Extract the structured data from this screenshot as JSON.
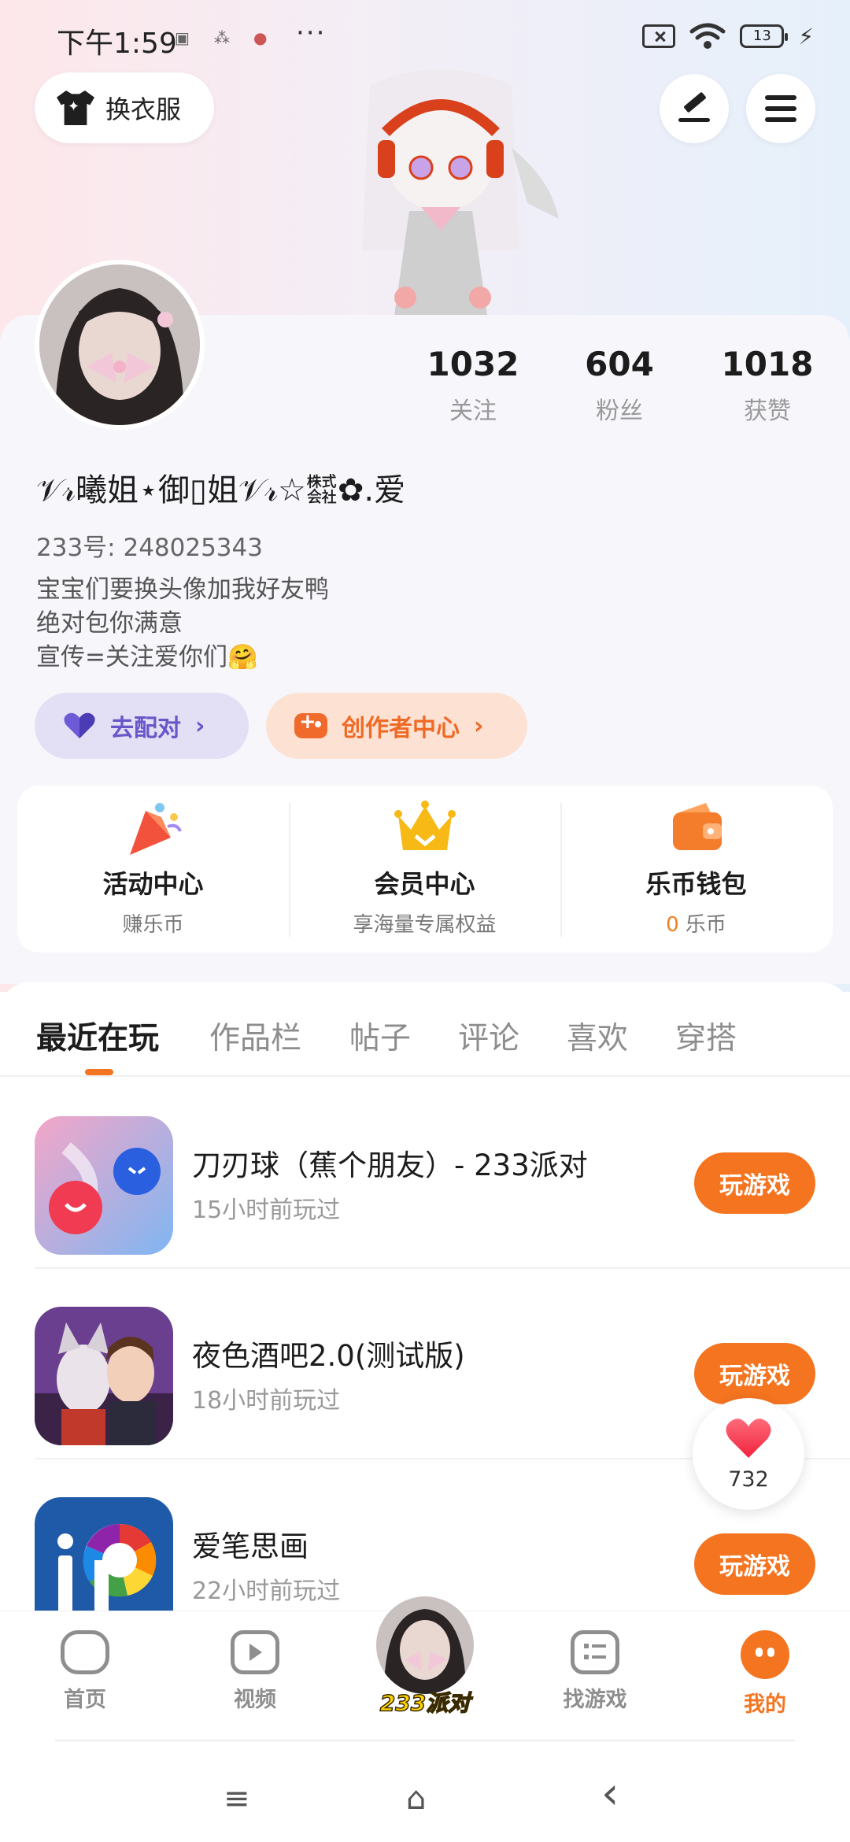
{
  "status_bar": {
    "time": "下午1:59",
    "more_dots": "···",
    "battery": "13"
  },
  "header": {
    "outfit_label": "换衣服"
  },
  "profile": {
    "stats": [
      {
        "value": "1032",
        "label": "关注"
      },
      {
        "value": "604",
        "label": "粉丝"
      },
      {
        "value": "1018",
        "label": "获赞"
      }
    ],
    "nickname": "𝒱𝓇曦姐⋆御▯姐𝒱𝓇☆㍿✿.爱",
    "uid": "233号: 248025343",
    "bio": [
      "宝宝们要换头像加我好友鸭",
      "绝对包你满意",
      "宣传=关注爱你们🤗"
    ],
    "match_label": "去配对",
    "creator_label": "创作者中心",
    "chevron": "›"
  },
  "features": [
    {
      "title": "活动中心",
      "subtitle": "赚乐币"
    },
    {
      "title": "会员中心",
      "subtitle": "享海量专属权益"
    },
    {
      "title": "乐币钱包",
      "coin": "0",
      "subtitle": "乐币"
    }
  ],
  "tabs": [
    "最近在玩",
    "作品栏",
    "帖子",
    "评论",
    "喜欢",
    "穿搭"
  ],
  "games": [
    {
      "title": "刀刃球（蕉个朋友）- 233派对",
      "time": "15小时前玩过",
      "button": "玩游戏"
    },
    {
      "title": "夜色酒吧2.0(测试版)",
      "time": "18小时前玩过",
      "button": "玩游戏"
    },
    {
      "title": "爱笔思画",
      "time": "22小时前玩过",
      "button": "玩游戏"
    }
  ],
  "like_count": "732",
  "bottom_nav": {
    "home": "首页",
    "video": "视频",
    "center": "233派对",
    "find": "找游戏",
    "me": "我的"
  },
  "system_nav": {
    "recent": "≡",
    "home": "⌂",
    "back": "‹"
  }
}
